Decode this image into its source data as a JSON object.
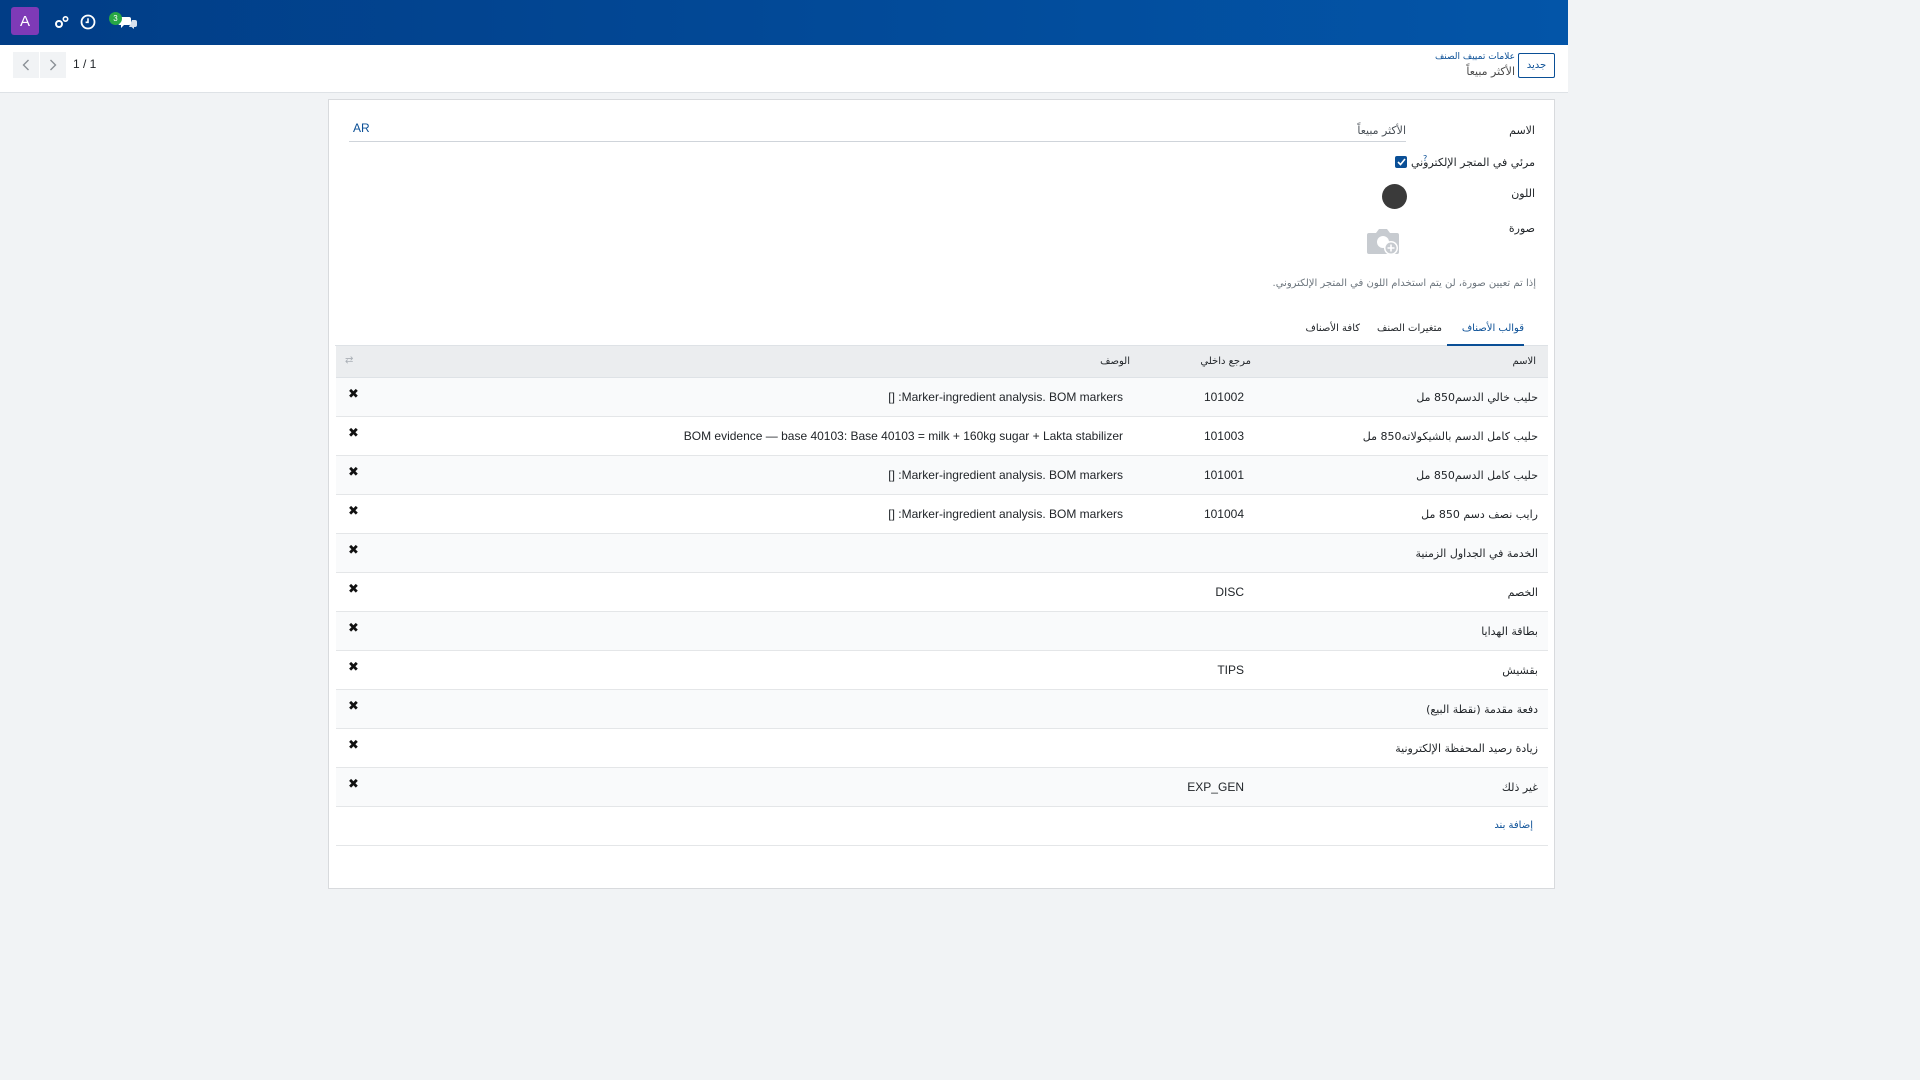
{
  "navbar": {
    "avatar_letter": "A",
    "messages_badge": "3",
    "brand_color": "#0355a8",
    "avatar_color": "#7e3ab7",
    "icons": [
      "settings-cogs-icon",
      "clock-icon",
      "chat-icon"
    ]
  },
  "breadcrumb": {
    "parent": "علامات تمييف الصنف",
    "current": "الأكثر مبيعاً"
  },
  "toolbar": {
    "new_label": "جديد"
  },
  "pager": {
    "value": "1 / 1"
  },
  "form": {
    "name_label": "الاسم",
    "name_value": "الأكثر مبيعاً",
    "lang_label": "AR",
    "ecommerce_label": "مرئي في المتجر الإلكتروني",
    "ecommerce_help": "?",
    "ecommerce_checked": true,
    "color_label": "اللون",
    "color_value": "#3a3a3a",
    "image_label": "صورة",
    "image_hint": "إذا تم تعيين صورة، لن يتم استخدام اللون في المتجر الإلكتروني."
  },
  "tabs": [
    {
      "label": "قوالب الأصناف",
      "active": true
    },
    {
      "label": "متغيرات الصنف",
      "active": false
    },
    {
      "label": "كافة الأصناف",
      "active": false
    }
  ],
  "table": {
    "columns": {
      "name": "الاسم",
      "ref": "مرجع داخلي",
      "desc": "الوصف"
    },
    "rows": [
      {
        "name": "حليب خالي الدسم850 مل",
        "ref": "101002",
        "desc": "[] :Marker-ingredient analysis. BOM markers"
      },
      {
        "name": "حليب كامل الدسم بالشيكولاته850 مل",
        "ref": "101003",
        "desc": "BOM evidence — base 40103: Base 40103 = milk + 160kg sugar + Lakta stabilizer"
      },
      {
        "name": "حليب كامل الدسم850 مل",
        "ref": "101001",
        "desc": "[] :Marker-ingredient analysis. BOM markers"
      },
      {
        "name": "رايب نصف دسم 850 مل",
        "ref": "101004",
        "desc": "[] :Marker-ingredient analysis. BOM markers"
      },
      {
        "name": "الخدمة في الجداول الزمنية",
        "ref": "",
        "desc": ""
      },
      {
        "name": "الخصم",
        "ref": "DISC",
        "desc": ""
      },
      {
        "name": "بطاقة الهدايا",
        "ref": "",
        "desc": ""
      },
      {
        "name": "بقشيش",
        "ref": "TIPS",
        "desc": ""
      },
      {
        "name": "دفعة مقدمة (نقطة البيع)",
        "ref": "",
        "desc": ""
      },
      {
        "name": "زيادة رصيد المحفظة الإلكترونية",
        "ref": "",
        "desc": ""
      },
      {
        "name": "غير ذلك",
        "ref": "EXP_GEN",
        "desc": ""
      }
    ],
    "add_line": "إضافة بند"
  }
}
